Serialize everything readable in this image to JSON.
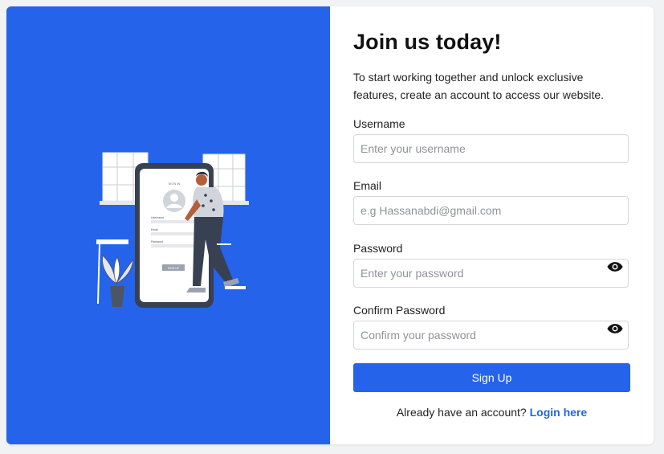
{
  "colors": {
    "accent": "#2563eb",
    "page_background": "#f1f2f4"
  },
  "illustration": {
    "icon": "signup-phone-illustration",
    "phone_form": {
      "heading": "SIGN IN",
      "username_label": "Username",
      "email_label": "Email",
      "password_label": "Password",
      "button_label": "SIGN UP"
    }
  },
  "form": {
    "title": "Join us today!",
    "intro": "To start working together and unlock exclusive features, create an account to access our website.",
    "username": {
      "label": "Username",
      "placeholder": "Enter your username",
      "value": ""
    },
    "email": {
      "label": "Email",
      "placeholder": "e.g Hassanabdi@gmail.com",
      "value": ""
    },
    "password": {
      "label": "Password",
      "placeholder": "Enter your password",
      "value": "",
      "toggle_icon": "eye-icon"
    },
    "confirm_password": {
      "label": "Confirm Password",
      "placeholder": "Confirm your password",
      "value": "",
      "toggle_icon": "eye-icon"
    },
    "submit_label": "Sign Up",
    "login_prompt": "Already have an account?",
    "login_link": "Login here"
  }
}
